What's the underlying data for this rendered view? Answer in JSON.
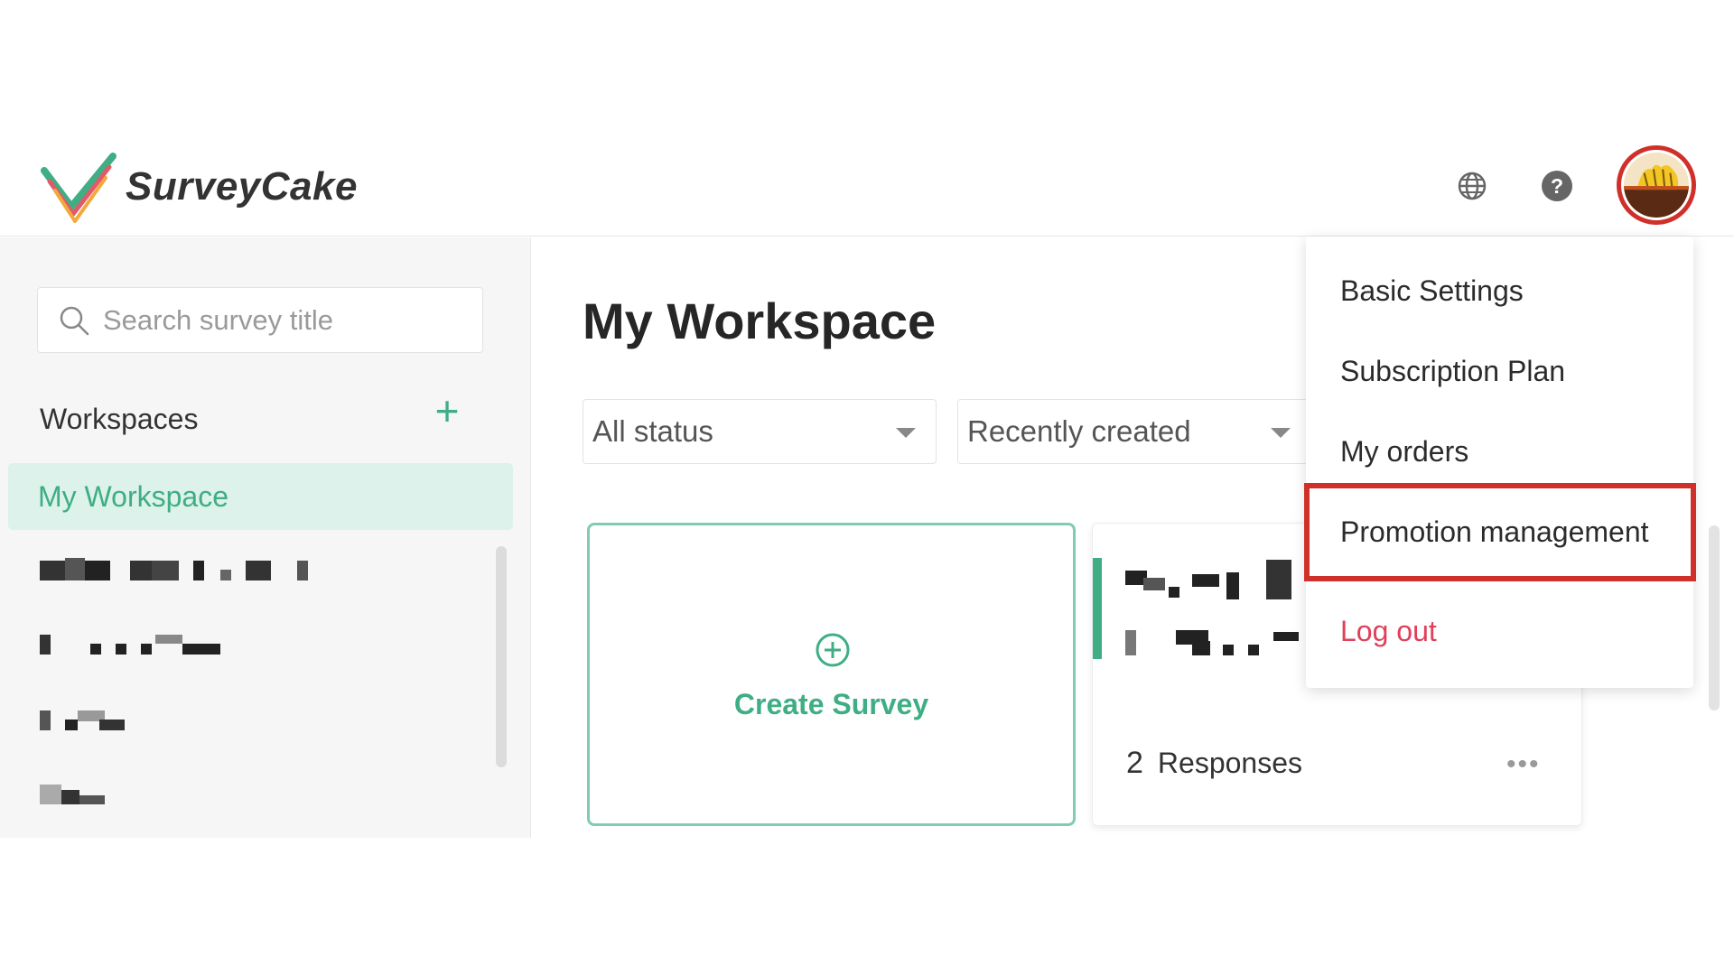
{
  "app": {
    "name": "SurveyCake"
  },
  "header": {
    "language_icon": "globe-icon",
    "help_icon": "question-icon",
    "help_glyph": "?",
    "avatar_icon": "user-avatar"
  },
  "sidebar": {
    "search": {
      "placeholder": "Search survey title",
      "value": ""
    },
    "workspaces_label": "Workspaces",
    "add_glyph": "+",
    "active_workspace": "My Workspace"
  },
  "main": {
    "title": "My Workspace",
    "status_filter": "All status",
    "sort_filter": "Recently created",
    "create_survey_label": "Create Survey",
    "survey_card": {
      "responses_count": "2",
      "responses_label": "Responses",
      "more_glyph": "•••"
    }
  },
  "account_menu": {
    "items": [
      {
        "label": "Basic Settings"
      },
      {
        "label": "Subscription Plan"
      },
      {
        "label": "My orders"
      },
      {
        "label": "Promotion management"
      },
      {
        "label": "Log out"
      }
    ]
  },
  "colors": {
    "brand_green": "#3fae84",
    "highlight_red": "#d0302a",
    "logout_red": "#e0405a"
  }
}
